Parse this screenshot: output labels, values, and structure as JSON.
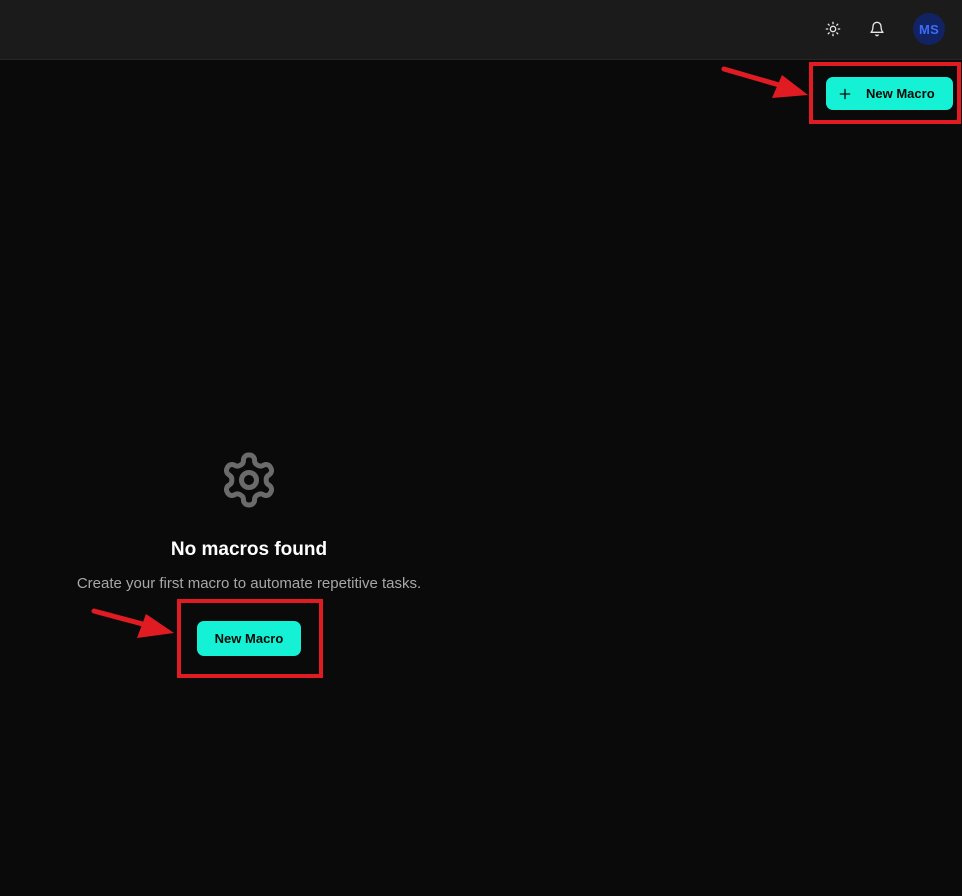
{
  "header": {
    "theme_toggle_icon": "sun-icon",
    "notifications_icon": "bell-icon",
    "avatar_initials": "MS",
    "avatar_bg": "#122364",
    "avatar_fg": "#3b6cf6"
  },
  "toolbar": {
    "new_macro_label": "New Macro",
    "new_macro_icon": "plus-icon"
  },
  "empty_state": {
    "icon": "gear-icon",
    "title": "No macros found",
    "description": "Create your first macro to automate repetitive tasks.",
    "button_label": "New Macro"
  },
  "colors": {
    "accent": "#14f1d4",
    "background": "#0a0a0a",
    "topbar": "#1b1b1b",
    "annotation": "#e11b22"
  }
}
